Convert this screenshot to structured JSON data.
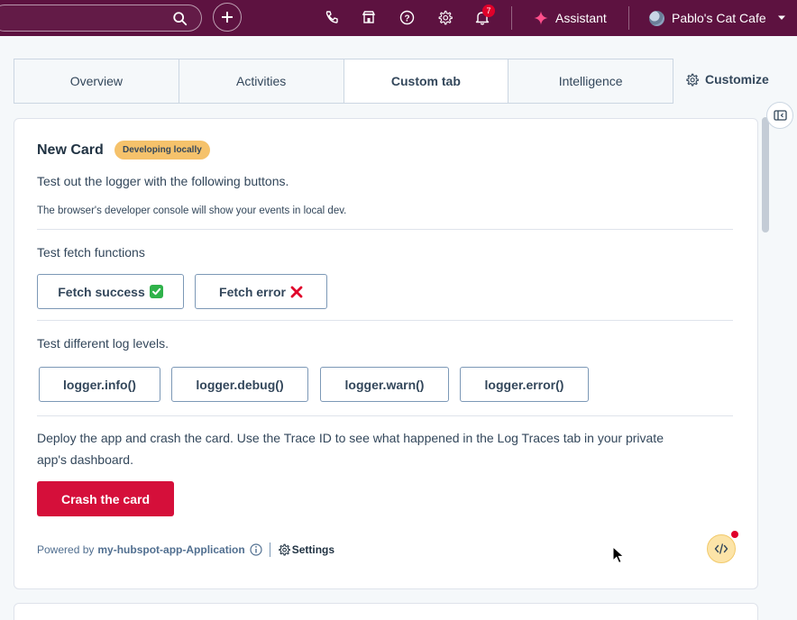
{
  "topnav": {
    "notification_count": "7",
    "assistant_label": "Assistant",
    "account_name": "Pablo's Cat Cafe",
    "icons": [
      "search-icon",
      "plus-icon",
      "phone-icon",
      "marketplace-icon",
      "help-icon",
      "settings-icon",
      "bell-icon",
      "sparkle-icon",
      "chevron-down-icon"
    ]
  },
  "tabs": [
    {
      "label": "Overview"
    },
    {
      "label": "Activities"
    },
    {
      "label": "Custom tab"
    },
    {
      "label": "Intelligence"
    }
  ],
  "active_tab": "Custom tab",
  "customize_label": "Customize",
  "card": {
    "title": "New Card",
    "badge": "Developing locally",
    "intro": "Test out the logger with the following buttons.",
    "console_note": "The browser's developer console will show your events in local dev.",
    "fetch_heading": "Test fetch functions",
    "fetch_buttons": [
      {
        "label": "Fetch success"
      },
      {
        "label": "Fetch error"
      }
    ],
    "log_heading": "Test different log levels.",
    "log_buttons": [
      {
        "label": "logger.info()"
      },
      {
        "label": "logger.debug()"
      },
      {
        "label": "logger.warn()"
      },
      {
        "label": "logger.error()"
      }
    ],
    "deploy_text_line1": "Deploy the app and crash the card. Use the Trace ID to see what happened in the Log Traces tab in your private",
    "deploy_text_line2": "app's dashboard.",
    "crash_button": "Crash the card",
    "footer": {
      "powered_by": "Powered by",
      "app_name": "my-hubspot-app-Application",
      "settings_label": "Settings"
    }
  },
  "colors": {
    "nav_bg": "#5d1240",
    "badge_bg": "#f5c26b",
    "crash_button": "#d50f3a",
    "notification": "#e0002a"
  }
}
